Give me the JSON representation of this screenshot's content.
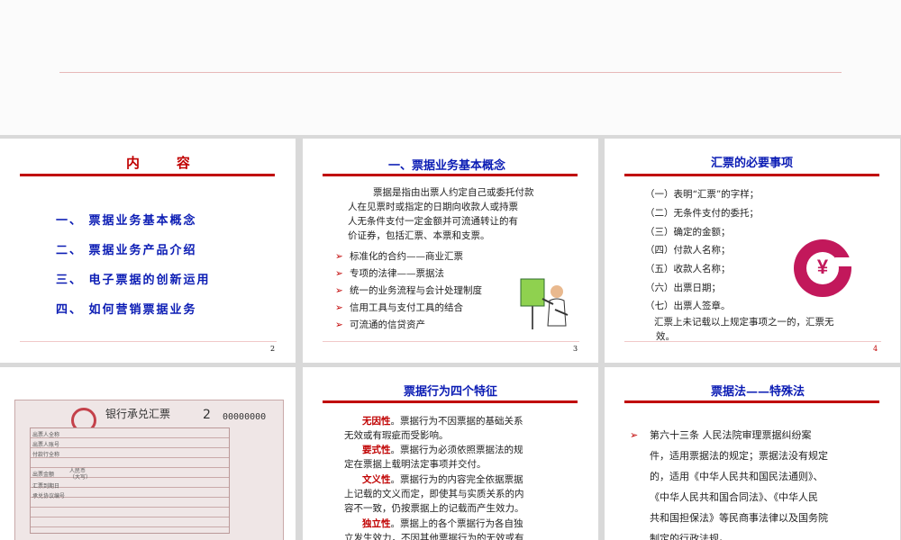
{
  "slides": {
    "contents": {
      "title": "内    容",
      "items": [
        "一、 票据业务基本概念",
        "二、 票据业务产品介绍",
        "三、 电子票据的创新运用",
        "四、 如何营销票据业务"
      ],
      "page": "2"
    },
    "concept": {
      "title": "一、票据业务基本概念",
      "intro": [
        "票据是指由出票人约定自己或委托付款",
        "人在见票时或指定的日期向收款人或持票",
        "人无条件支付一定金额并可流通转让的有",
        "价证券，包括汇票、本票和支票。"
      ],
      "bullets": [
        "标准化的合约——商业汇票",
        "专项的法律——票据法",
        "统一的业务流程与会计处理制度",
        "信用工具与支付工具的结合",
        "可流通的信贷资产"
      ],
      "page": "3"
    },
    "requirements": {
      "title": "汇票的必要事项",
      "items": [
        "（一）表明“汇票”的字样；",
        "（二）无条件支付的委托；",
        "（三）确定的金额；",
        "（四）付款人名称；",
        "（五）收款人名称；",
        "（六）出票日期；",
        "（七）出票人签章。"
      ],
      "note": [
        "汇票上未记载以上规定事项之一的，汇票无",
        "效。"
      ],
      "logo_symbol": "¥",
      "page": "4"
    },
    "bill": {
      "header": "银行承兑汇票",
      "number_prefix": "2",
      "number": "00000000",
      "fields": [
        "出票人全称",
        "出票人账号",
        "付款行全称",
        "出票金额",
        "汇票到期日",
        "承兑协议编号"
      ],
      "currency_label": "人民币",
      "currency_label2": "（大写）"
    },
    "features": {
      "title": "票据行为四个特征",
      "paras": [
        {
          "key": "无因性",
          "lines": [
            "。票据行为不因票据的基础关系",
            "无效或有瑕疵而受影响。"
          ]
        },
        {
          "key": "要式性",
          "lines": [
            "。票据行为必须依照票据法的规",
            "定在票据上载明法定事项并交付。"
          ]
        },
        {
          "key": "文义性",
          "lines": [
            "。票据行为的内容完全依据票据",
            "上记载的文义而定，即使其与实质关系的内",
            "容不一致，仍按票据上的记载而产生效力。"
          ]
        },
        {
          "key": "独立性",
          "lines": [
            "。票据上的各个票据行为各自独",
            "立发生效力，不因其他票据行为的无效或有"
          ]
        }
      ]
    },
    "law": {
      "title": "票据法——特殊法",
      "lines": [
        "第六十三条   人民法院审理票据纠纷案",
        "件，适用票据法的规定；票据法没有规定",
        "的，适用《中华人民共和国民法通则》、",
        "《中华人民共和国合同法》、《中华人民",
        "共和国担保法》等民商事法律以及国务院",
        "制定的行政法规。"
      ]
    }
  }
}
